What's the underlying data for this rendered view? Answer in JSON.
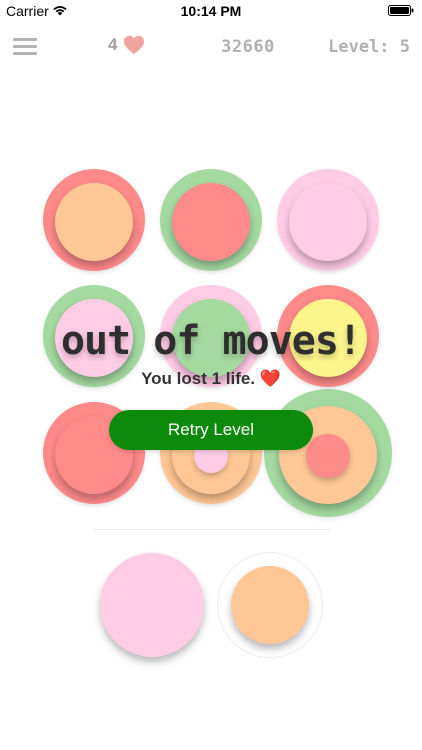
{
  "status_bar": {
    "carrier": "Carrier",
    "time": "10:14 PM"
  },
  "header": {
    "lives": "4",
    "score": "32660",
    "level": "Level: 5",
    "heart_color": "#f2a39b"
  },
  "colors": {
    "red": "#ff8a8a",
    "green": "#a4d9a0",
    "pink": "#ffcce6",
    "peach": "#ffc795",
    "yellow": "#fbf58b",
    "retry_green": "#0b8a0b"
  },
  "board": {
    "rows": 3,
    "cols": 3,
    "cells": [
      {
        "outer": "red",
        "inner": "peach"
      },
      {
        "outer": "green",
        "inner": "red"
      },
      {
        "outer": "pink",
        "inner": "pink"
      },
      {
        "outer": "green",
        "inner": "pink"
      },
      {
        "outer": "pink",
        "inner": "green"
      },
      {
        "outer": "red",
        "inner": "yellow"
      },
      {
        "outer": "red",
        "inner": "red"
      },
      {
        "outer": "peach",
        "inner": "peach",
        "core": "pink"
      },
      {
        "outer": "green",
        "inner": "peach",
        "core": "red",
        "selected": true
      }
    ]
  },
  "tray": [
    {
      "color": "pink"
    },
    {
      "color": "peach",
      "outlined": true
    }
  ],
  "overlay": {
    "title": "out of moves!",
    "subtitle": "You lost 1 life. ❤️",
    "retry_label": "Retry Level"
  }
}
